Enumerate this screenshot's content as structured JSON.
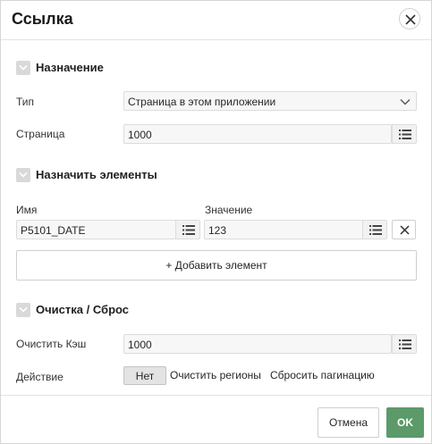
{
  "dialog": {
    "title": "Ссылка",
    "close_icon": "close-icon"
  },
  "sections": {
    "target": {
      "title": "Назначение"
    },
    "items": {
      "title": "Назначить элементы"
    },
    "clear": {
      "title": "Очистка / Сброс"
    }
  },
  "target": {
    "type_label": "Тип",
    "type_value": "Страница в этом приложении",
    "page_label": "Страница",
    "page_value": "1000"
  },
  "items": {
    "name_header": "Имя",
    "value_header": "Значение",
    "rows": [
      {
        "name": "P5101_DATE",
        "value": "123"
      }
    ],
    "add_label": "+ Добавить элемент"
  },
  "clear": {
    "cache_label": "Очистить Кэш",
    "cache_value": "1000",
    "action_label": "Действие",
    "action_options": [
      "Нет",
      "Очистить регионы",
      "Сбросить пагинацию"
    ],
    "action_selected": "Нет"
  },
  "footer": {
    "cancel_label": "Отмена",
    "ok_label": "OK"
  },
  "colors": {
    "ok_button": "#5c9a6a",
    "field_bg": "#f7f7f7",
    "border": "#dcdcdc"
  }
}
